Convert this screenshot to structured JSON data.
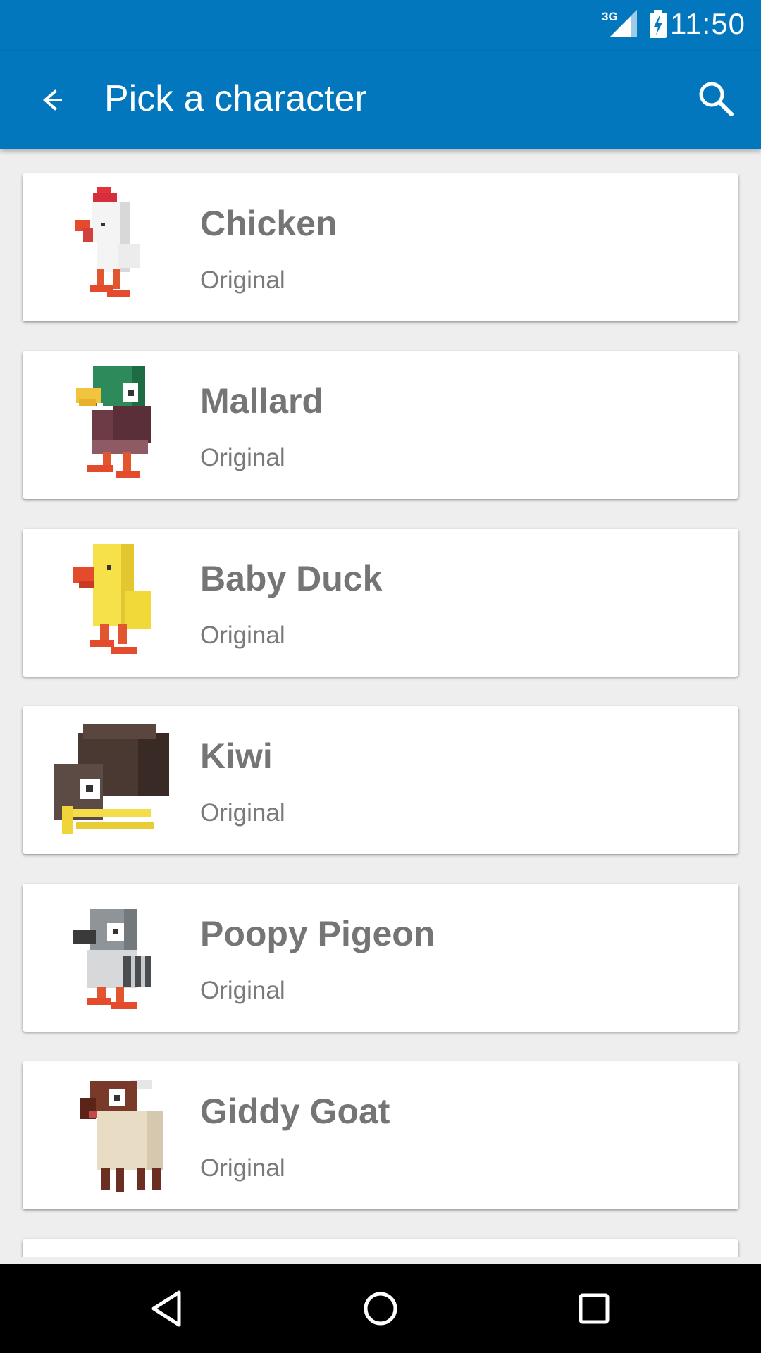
{
  "status_bar": {
    "network": "3G",
    "time": "11:50",
    "icons": [
      "signal-icon",
      "battery-charging-icon"
    ]
  },
  "app_bar": {
    "title": "Pick a character",
    "back_icon": "arrow-back-icon",
    "search_icon": "search-icon"
  },
  "characters": [
    {
      "name": "Chicken",
      "subtitle": "Original",
      "icon": "chicken-icon"
    },
    {
      "name": "Mallard",
      "subtitle": "Original",
      "icon": "mallard-icon"
    },
    {
      "name": "Baby Duck",
      "subtitle": "Original",
      "icon": "baby-duck-icon"
    },
    {
      "name": "Kiwi",
      "subtitle": "Original",
      "icon": "kiwi-icon"
    },
    {
      "name": "Poopy Pigeon",
      "subtitle": "Original",
      "icon": "pigeon-icon"
    },
    {
      "name": "Giddy Goat",
      "subtitle": "Original",
      "icon": "goat-icon"
    }
  ],
  "nav_bar": {
    "icons": [
      "nav-back-icon",
      "nav-home-icon",
      "nav-recents-icon"
    ]
  },
  "colors": {
    "primary": "#0277bd",
    "background": "#eeeeee",
    "card": "#ffffff",
    "text": "#757575"
  }
}
